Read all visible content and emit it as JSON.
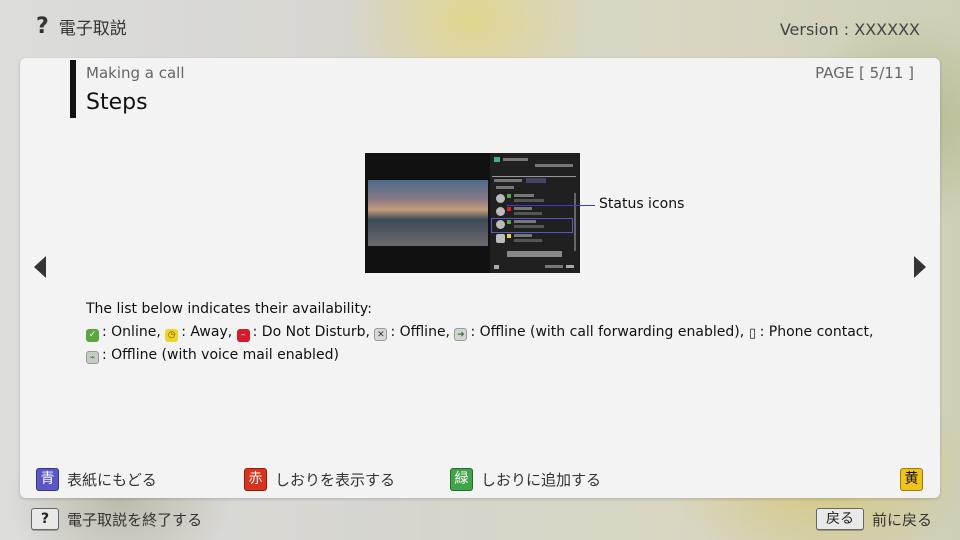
{
  "header": {
    "help_glyph": "?",
    "title": "電子取説",
    "version": "Version : XXXXXX"
  },
  "panel": {
    "section_title": "Making a call",
    "heading": "Steps",
    "page_indicator": "PAGE [ 5/11 ]",
    "figure": {
      "callout": "Status icons"
    },
    "description": {
      "lead": "The list below indicates their availability:",
      "items": [
        {
          "icon": "status-online-icon",
          "glyph": "✓",
          "label": ": Online, "
        },
        {
          "icon": "status-away-icon",
          "glyph": "◷",
          "label": ": Away, "
        },
        {
          "icon": "status-dnd-icon",
          "glyph": "–",
          "label": ": Do Not Disturb, "
        },
        {
          "icon": "status-offline-icon",
          "glyph": "✕",
          "label": ": Offline, "
        },
        {
          "icon": "status-offline-forwarding-icon",
          "glyph": "➜",
          "label": ": Offline (with call forwarding enabled), "
        },
        {
          "icon": "status-phone-contact-icon",
          "glyph": "▯",
          "label": ": Phone contact, "
        },
        {
          "icon": "status-offline-voicemail-icon",
          "glyph": "⌁",
          "label": ": Offline (with voice mail enabled)"
        }
      ]
    }
  },
  "color_buttons": {
    "blue": {
      "key": "青",
      "label": "表紙にもどる",
      "color": "#5a56c8"
    },
    "red": {
      "key": "赤",
      "label": "しおりを表示する",
      "color": "#d8331f"
    },
    "green": {
      "key": "緑",
      "label": "しおりに追加する",
      "color": "#3ea548"
    },
    "yellow": {
      "key": "黄",
      "label": "",
      "color": "#f0c21a"
    }
  },
  "footer": {
    "exit_key": "?",
    "exit_label": "電子取説を終了する",
    "back_key": "戻る",
    "back_label": "前に戻る"
  }
}
